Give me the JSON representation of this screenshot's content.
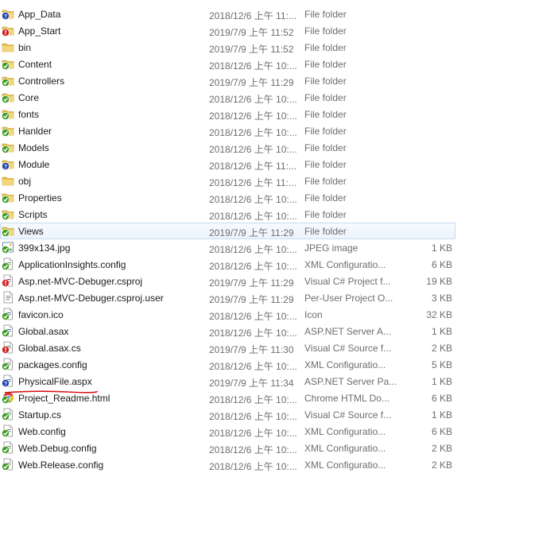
{
  "colors": {
    "folder": "#e8c04a",
    "status_ok": "#3b9a1f",
    "status_warn": "#cc2222",
    "status_unknown": "#2440a8",
    "annotation": "#d9141b",
    "selection_border": "#c6daf3"
  },
  "files": [
    {
      "name": "App_Data",
      "date": "2018/12/6 上午 11:...",
      "type": "File folder",
      "size": "",
      "icon": "folder-icon",
      "status": "unknown"
    },
    {
      "name": "App_Start",
      "date": "2019/7/9 上午 11:52",
      "type": "File folder",
      "size": "",
      "icon": "folder-icon",
      "status": "warn"
    },
    {
      "name": "bin",
      "date": "2019/7/9 上午 11:52",
      "type": "File folder",
      "size": "",
      "icon": "folder-icon",
      "status": "none"
    },
    {
      "name": "Content",
      "date": "2018/12/6 上午 10:...",
      "type": "File folder",
      "size": "",
      "icon": "folder-icon",
      "status": "ok"
    },
    {
      "name": "Controllers",
      "date": "2019/7/9 上午 11:29",
      "type": "File folder",
      "size": "",
      "icon": "folder-icon",
      "status": "ok"
    },
    {
      "name": "Core",
      "date": "2018/12/6 上午 10:...",
      "type": "File folder",
      "size": "",
      "icon": "folder-icon",
      "status": "ok"
    },
    {
      "name": "fonts",
      "date": "2018/12/6 上午 10:...",
      "type": "File folder",
      "size": "",
      "icon": "folder-icon",
      "status": "ok"
    },
    {
      "name": "Hanlder",
      "date": "2018/12/6 上午 10:...",
      "type": "File folder",
      "size": "",
      "icon": "folder-icon",
      "status": "ok"
    },
    {
      "name": "Models",
      "date": "2018/12/6 上午 10:...",
      "type": "File folder",
      "size": "",
      "icon": "folder-icon",
      "status": "ok"
    },
    {
      "name": "Module",
      "date": "2018/12/6 上午 11:...",
      "type": "File folder",
      "size": "",
      "icon": "folder-icon",
      "status": "unknown"
    },
    {
      "name": "obj",
      "date": "2018/12/6 上午 11:...",
      "type": "File folder",
      "size": "",
      "icon": "folder-icon",
      "status": "none"
    },
    {
      "name": "Properties",
      "date": "2018/12/6 上午 10:...",
      "type": "File folder",
      "size": "",
      "icon": "folder-icon",
      "status": "ok"
    },
    {
      "name": "Scripts",
      "date": "2018/12/6 上午 10:...",
      "type": "File folder",
      "size": "",
      "icon": "folder-icon",
      "status": "ok"
    },
    {
      "name": "Views",
      "date": "2019/7/9 上午 11:29",
      "type": "File folder",
      "size": "",
      "icon": "folder-icon",
      "status": "ok",
      "selected": true
    },
    {
      "name": "399x134.jpg",
      "date": "2018/12/6 上午 10:...",
      "type": "JPEG image",
      "size": "1 KB",
      "icon": "image-file-icon",
      "status": "ok"
    },
    {
      "name": "ApplicationInsights.config",
      "date": "2018/12/6 上午 10:...",
      "type": "XML Configuratio...",
      "size": "6 KB",
      "icon": "config-file-icon",
      "status": "ok"
    },
    {
      "name": "Asp.net-MVC-Debuger.csproj",
      "date": "2019/7/9 上午 11:29",
      "type": "Visual C# Project f...",
      "size": "19 KB",
      "icon": "project-file-icon",
      "status": "warn"
    },
    {
      "name": "Asp.net-MVC-Debuger.csproj.user",
      "date": "2019/7/9 上午 11:29",
      "type": "Per-User Project O...",
      "size": "3 KB",
      "icon": "user-file-icon",
      "status": "none"
    },
    {
      "name": "favicon.ico",
      "date": "2018/12/6 上午 10:...",
      "type": "Icon",
      "size": "32 KB",
      "icon": "ico-file-icon",
      "status": "ok"
    },
    {
      "name": "Global.asax",
      "date": "2018/12/6 上午 10:...",
      "type": "ASP.NET Server A...",
      "size": "1 KB",
      "icon": "asax-file-icon",
      "status": "ok"
    },
    {
      "name": "Global.asax.cs",
      "date": "2019/7/9 上午 11:30",
      "type": "Visual C# Source f...",
      "size": "2 KB",
      "icon": "cs-file-icon",
      "status": "warn"
    },
    {
      "name": "packages.config",
      "date": "2018/12/6 上午 10:...",
      "type": "XML Configuratio...",
      "size": "5 KB",
      "icon": "config-file-icon",
      "status": "ok"
    },
    {
      "name": "PhysicalFile.aspx",
      "date": "2019/7/9 上午 11:34",
      "type": "ASP.NET Server Pa...",
      "size": "1 KB",
      "icon": "aspx-file-icon",
      "status": "unknown"
    },
    {
      "name": "Project_Readme.html",
      "date": "2018/12/6 上午 10:...",
      "type": "Chrome HTML Do...",
      "size": "6 KB",
      "icon": "html-file-icon",
      "status": "ok"
    },
    {
      "name": "Startup.cs",
      "date": "2018/12/6 上午 10:...",
      "type": "Visual C# Source f...",
      "size": "1 KB",
      "icon": "cs-file-icon",
      "status": "ok"
    },
    {
      "name": "Web.config",
      "date": "2018/12/6 上午 10:...",
      "type": "XML Configuratio...",
      "size": "6 KB",
      "icon": "config-file-icon",
      "status": "ok"
    },
    {
      "name": "Web.Debug.config",
      "date": "2018/12/6 上午 10:...",
      "type": "XML Configuratio...",
      "size": "2 KB",
      "icon": "config-file-icon",
      "status": "ok"
    },
    {
      "name": "Web.Release.config",
      "date": "2018/12/6 上午 10:...",
      "type": "XML Configuratio...",
      "size": "2 KB",
      "icon": "config-file-icon",
      "status": "ok"
    }
  ]
}
